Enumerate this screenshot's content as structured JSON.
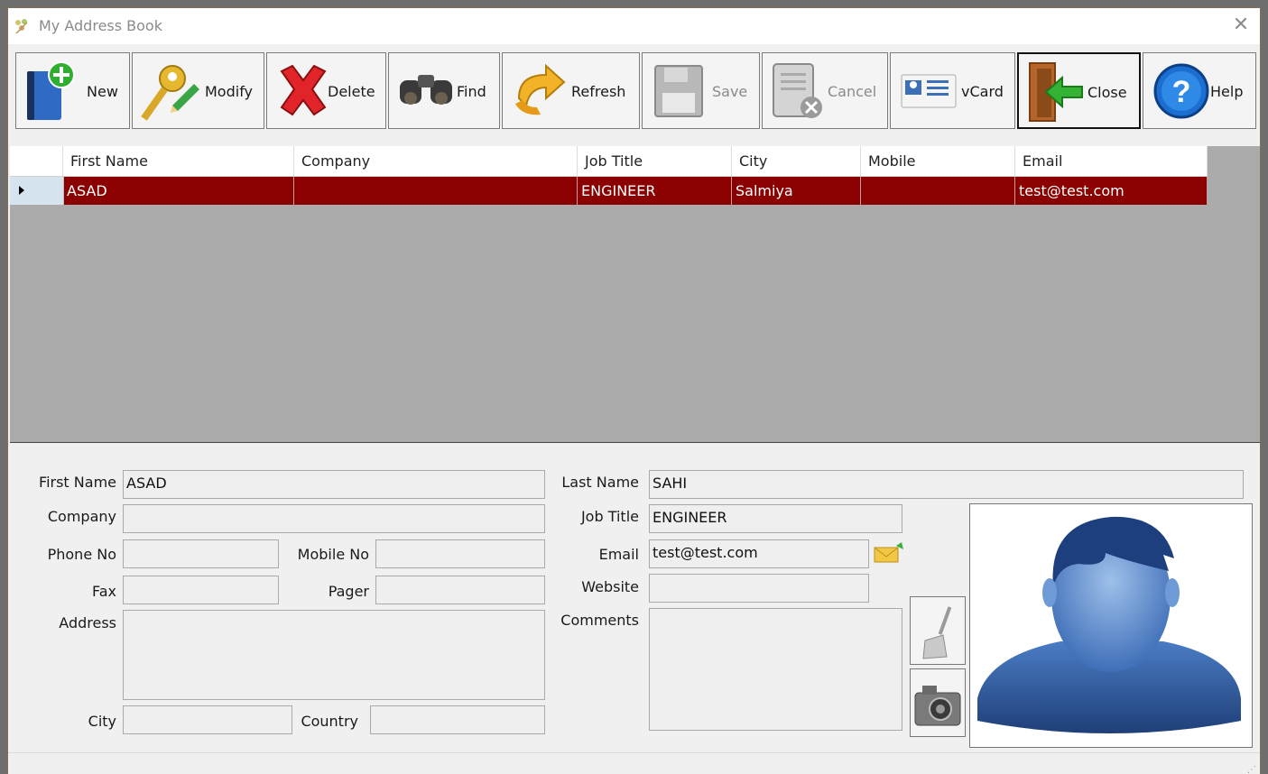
{
  "window": {
    "title": "My Address Book",
    "close_glyph": "✕"
  },
  "toolbar": {
    "new": "New",
    "modify": "Modify",
    "delete": "Delete",
    "find": "Find",
    "refresh": "Refresh",
    "save": "Save",
    "cancel": "Cancel",
    "vcard": "vCard",
    "close": "Close",
    "help": "Help"
  },
  "grid": {
    "columns": [
      "First Name",
      "Company",
      "Job Title",
      "City",
      "Mobile",
      "Email"
    ],
    "rows": [
      {
        "first_name": "ASAD",
        "company": "",
        "job_title": "ENGINEER",
        "city": "Salmiya",
        "mobile": "",
        "email": "test@test.com"
      }
    ]
  },
  "form": {
    "labels": {
      "first_name": "First Name",
      "company": "Company",
      "phone_no": "Phone No",
      "mobile_no": "Mobile No",
      "fax": "Fax",
      "pager": "Pager",
      "address": "Address",
      "city": "City",
      "country": "Country",
      "last_name": "Last Name",
      "job_title": "Job Title",
      "email": "Email",
      "website": "Website",
      "comments": "Comments"
    },
    "values": {
      "first_name": "ASAD",
      "company": "",
      "phone_no": "",
      "mobile_no": "",
      "fax": "",
      "pager": "",
      "address": "",
      "city": "",
      "country": "",
      "last_name": "SAHI",
      "job_title": "ENGINEER",
      "email": "test@test.com",
      "website": "",
      "comments": ""
    }
  },
  "colors": {
    "selected_row": "#8b0000",
    "grid_background": "#ababab",
    "avatar_blue": "#2c5aa0"
  }
}
